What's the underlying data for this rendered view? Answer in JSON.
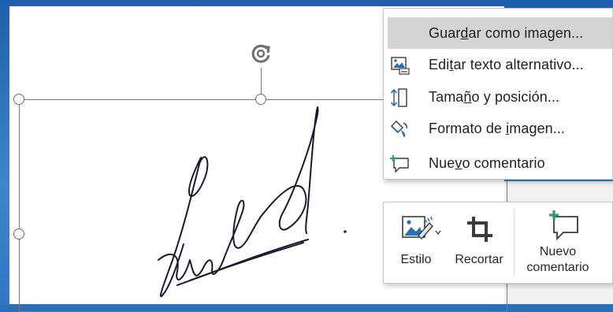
{
  "context_menu": {
    "items": [
      {
        "id": "save",
        "pre": "Guar",
        "acc": "d",
        "post": "ar como imagen...",
        "icon": "save-image-icon",
        "highlighted": true
      },
      {
        "id": "alt",
        "pre": "Edi",
        "acc": "t",
        "post": "ar texto alternativo...",
        "icon": "alt-text-icon",
        "highlighted": false
      },
      {
        "id": "size",
        "pre": "Tama",
        "acc": "ñ",
        "post": "o y posición...",
        "icon": "size-position-icon",
        "highlighted": false
      },
      {
        "id": "format",
        "pre": "Formato de ",
        "acc": "i",
        "post": "magen...",
        "icon": "format-picture-icon",
        "highlighted": false
      },
      {
        "id": "comment",
        "pre": "Nue",
        "acc": "v",
        "post": "o comentario",
        "icon": "new-comment-icon",
        "highlighted": false
      }
    ]
  },
  "mini_toolbar": {
    "style_label": "Estilo",
    "crop_label": "Recortar",
    "comment_label_line1": "Nuevo",
    "comment_label_line2": "comentario"
  },
  "colors": {
    "highlight": "#d4d4d4",
    "accent_blue": "#2b6fb8",
    "comment_green": "#2e9c6f",
    "ink": "#1a1a2e"
  }
}
